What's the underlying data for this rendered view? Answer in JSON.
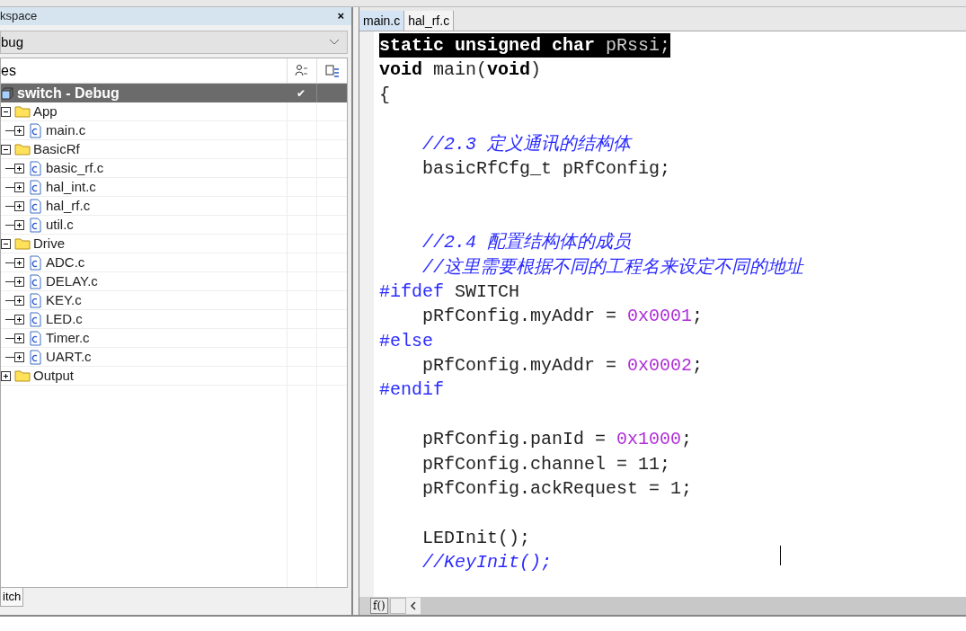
{
  "workspace": {
    "title": "kspace",
    "close": "×",
    "config": "bug",
    "header": "es",
    "project": {
      "label": "switch - Debug",
      "selected": true,
      "check": "✔"
    },
    "tree": [
      {
        "label": "App",
        "kind": "folder",
        "expanded": true,
        "children": [
          {
            "label": "main.c",
            "kind": "file"
          }
        ]
      },
      {
        "label": "BasicRf",
        "kind": "folder",
        "expanded": true,
        "children": [
          {
            "label": "basic_rf.c",
            "kind": "file"
          },
          {
            "label": "hal_int.c",
            "kind": "file"
          },
          {
            "label": "hal_rf.c",
            "kind": "file"
          },
          {
            "label": "util.c",
            "kind": "file"
          }
        ]
      },
      {
        "label": "Drive",
        "kind": "folder",
        "expanded": true,
        "children": [
          {
            "label": "ADC.c",
            "kind": "file"
          },
          {
            "label": "DELAY.c",
            "kind": "file"
          },
          {
            "label": "KEY.c",
            "kind": "file"
          },
          {
            "label": "LED.c",
            "kind": "file"
          },
          {
            "label": "Timer.c",
            "kind": "file"
          },
          {
            "label": "UART.c",
            "kind": "file"
          }
        ]
      },
      {
        "label": "Output",
        "kind": "folder",
        "expanded": false
      }
    ],
    "bottom_tab": "itch"
  },
  "editor": {
    "tabs": [
      {
        "label": "main.c",
        "selected": true
      },
      {
        "label": "hal_rf.c",
        "selected": false
      }
    ],
    "lines": [
      {
        "kind": "code",
        "selected": true,
        "tokens": [
          {
            "kind": "keyword",
            "text": "static unsigned char"
          },
          {
            "kind": "plain",
            "text": " pRssi;"
          }
        ]
      },
      {
        "kind": "code",
        "selected": false,
        "tokens": [
          {
            "kind": "keyword",
            "text": "void"
          },
          {
            "kind": "plain",
            "text": " main("
          },
          {
            "kind": "keyword",
            "text": "void"
          },
          {
            "kind": "plain",
            "text": ")"
          }
        ]
      },
      {
        "kind": "code",
        "selected": false,
        "tokens": [
          {
            "kind": "plain",
            "text": "{"
          }
        ]
      },
      {
        "kind": "blank"
      },
      {
        "kind": "code",
        "selected": false,
        "tokens": [
          {
            "kind": "comment",
            "text": "    //2.3 定义通讯的结构体"
          }
        ]
      },
      {
        "kind": "code",
        "selected": false,
        "tokens": [
          {
            "kind": "plain",
            "text": "    basicRfCfg_t pRfConfig;"
          }
        ]
      },
      {
        "kind": "blank"
      },
      {
        "kind": "blank"
      },
      {
        "kind": "code",
        "selected": false,
        "tokens": [
          {
            "kind": "comment",
            "text": "    //2.4 配置结构体的成员"
          }
        ]
      },
      {
        "kind": "code",
        "selected": false,
        "tokens": [
          {
            "kind": "comment",
            "text": "    //这里需要根据不同的工程名来设定不同的地址"
          }
        ]
      },
      {
        "kind": "code",
        "selected": false,
        "tokens": [
          {
            "kind": "preproc",
            "text": "#ifdef"
          },
          {
            "kind": "plain",
            "text": " SWITCH"
          }
        ]
      },
      {
        "kind": "code",
        "selected": false,
        "tokens": [
          {
            "kind": "plain",
            "text": "    pRfConfig.myAddr = "
          },
          {
            "kind": "number",
            "text": "0x0001"
          },
          {
            "kind": "plain",
            "text": ";"
          }
        ]
      },
      {
        "kind": "code",
        "selected": false,
        "tokens": [
          {
            "kind": "preproc",
            "text": "#else"
          }
        ]
      },
      {
        "kind": "code",
        "selected": false,
        "tokens": [
          {
            "kind": "plain",
            "text": "    pRfConfig.myAddr = "
          },
          {
            "kind": "number",
            "text": "0x0002"
          },
          {
            "kind": "plain",
            "text": ";"
          }
        ]
      },
      {
        "kind": "code",
        "selected": false,
        "tokens": [
          {
            "kind": "preproc",
            "text": "#endif"
          }
        ]
      },
      {
        "kind": "blank"
      },
      {
        "kind": "code",
        "selected": false,
        "tokens": [
          {
            "kind": "plain",
            "text": "    pRfConfig.panId = "
          },
          {
            "kind": "number",
            "text": "0x1000"
          },
          {
            "kind": "plain",
            "text": ";"
          }
        ]
      },
      {
        "kind": "code",
        "selected": false,
        "tokens": [
          {
            "kind": "plain",
            "text": "    pRfConfig.channel = 11;"
          }
        ]
      },
      {
        "kind": "code",
        "selected": false,
        "tokens": [
          {
            "kind": "plain",
            "text": "    pRfConfig.ackRequest = 1;"
          }
        ]
      },
      {
        "kind": "blank"
      },
      {
        "kind": "code",
        "selected": false,
        "tokens": [
          {
            "kind": "plain",
            "text": "    LEDInit();"
          }
        ]
      },
      {
        "kind": "code",
        "selected": false,
        "tokens": [
          {
            "kind": "comment",
            "text": "    //KeyInit();"
          }
        ]
      }
    ],
    "footer_button": "f()"
  }
}
